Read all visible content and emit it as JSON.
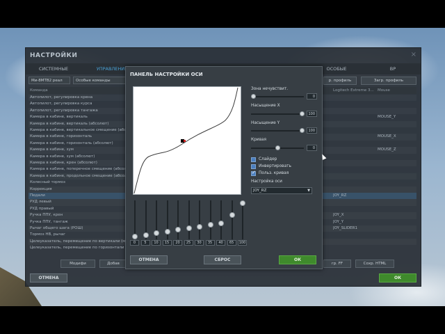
{
  "settings_window": {
    "title": "НАСТРОЙКИ",
    "close_glyph": "×",
    "tabs": [
      "СИСТЕМНЫЕ",
      "УПРАВЛЕНИЕ",
      "ОСОБЫЕ",
      "ВР"
    ],
    "aircraft_combo": "Ми-8МТВ2 реал",
    "category_combo": "Особые команды",
    "save_profile": "р. профиль",
    "load_profile": "Загр. профиль",
    "columns": [
      "Команда",
      "Logitech Extreme 3...",
      "Mouse"
    ],
    "rows": [
      {
        "cmd": "Автопилот, регулировка крена",
        "dev": "",
        "mouse": ""
      },
      {
        "cmd": "Автопилот, регулировка курса",
        "dev": "",
        "mouse": ""
      },
      {
        "cmd": "Автопилот, регулировка тангажа",
        "dev": "",
        "mouse": ""
      },
      {
        "cmd": "Камера в кабине, вертикаль",
        "dev": "",
        "mouse": "MOUSE_Y"
      },
      {
        "cmd": "Камера в кабине, вертикаль (абсолют)",
        "dev": "",
        "mouse": ""
      },
      {
        "cmd": "Камера в кабине, вертикальное смещение (абсол",
        "dev": "",
        "mouse": ""
      },
      {
        "cmd": "Камера в кабине, горизонталь",
        "dev": "",
        "mouse": "MOUSE_X"
      },
      {
        "cmd": "Камера в кабине, горизонталь (абсолют)",
        "dev": "",
        "mouse": ""
      },
      {
        "cmd": "Камера в кабине, зум",
        "dev": "",
        "mouse": "MOUSE_Z"
      },
      {
        "cmd": "Камера в кабине, зум (абсолют)",
        "dev": "",
        "mouse": ""
      },
      {
        "cmd": "Камера в кабине, крен (абсолют)",
        "dev": "",
        "mouse": ""
      },
      {
        "cmd": "Камера в кабине, поперечное смещение (абсол",
        "dev": "",
        "mouse": ""
      },
      {
        "cmd": "Камера в кабине, продольное смещение (абсол",
        "dev": "",
        "mouse": ""
      },
      {
        "cmd": "Колесный тормоз",
        "dev": "",
        "mouse": ""
      },
      {
        "cmd": "Коррекция",
        "dev": "",
        "mouse": ""
      },
      {
        "cmd": "Педали",
        "dev": "JOY_RZ",
        "mouse": ""
      },
      {
        "cmd": "РУД левый",
        "dev": "",
        "mouse": ""
      },
      {
        "cmd": "РУД правый",
        "dev": "",
        "mouse": ""
      },
      {
        "cmd": "Ручка ППУ, крен",
        "dev": "JOY_X",
        "mouse": ""
      },
      {
        "cmd": "Ручка ППУ, тангаж",
        "dev": "JOY_Y",
        "mouse": ""
      },
      {
        "cmd": "Рычаг общего шага (РОШ)",
        "dev": "JOY_SLIDER1",
        "mouse": ""
      },
      {
        "cmd": "Тормоз НВ, рычаг",
        "dev": "",
        "mouse": ""
      },
      {
        "cmd": "Целеуказатель, перемещение по вертикали (мы",
        "dev": "",
        "mouse": ""
      },
      {
        "cmd": "Целеуказатель, перемещение по горизонтали (м",
        "dev": "",
        "mouse": ""
      }
    ],
    "bottom_buttons": [
      "Модифи",
      "Добав",
      "гр. FF",
      "Сохр. HTML"
    ],
    "footer_cancel": "ОТМЕНА",
    "footer_ok": "ОК"
  },
  "axis_dialog": {
    "title": "ПАНЕЛЬ НАСТРОЙКИ ОСИ",
    "deadzone_label": "Зона нечувствит.",
    "deadzone_value": "0",
    "saturation_x_label": "Насыщение X",
    "saturation_x_value": "100",
    "saturation_y_label": "Насыщение Y",
    "saturation_y_value": "100",
    "curve_label": "Кривая",
    "curve_value": "0",
    "checkbox_slider": "Слайдер",
    "checkbox_invert": "Инвертировать",
    "checkbox_user_curve": "Польз. кривая",
    "axis_setting_label": "Настройка оси",
    "axis_value": "JOY_RZ",
    "eq_labels": [
      "0",
      "5",
      "10",
      "15",
      "20",
      "25",
      "30",
      "35",
      "40",
      "65",
      "100"
    ],
    "eq_levels": [
      0.0,
      0.05,
      0.1,
      0.15,
      0.2,
      0.25,
      0.3,
      0.35,
      0.4,
      0.65,
      1.0
    ],
    "cancel_button": "ОТМЕНА",
    "reset_button": "СБРОС",
    "ok_button": "ОК"
  },
  "colors": {
    "accent_tab": "#4aa3d8",
    "ok_green": "#3f8a2c"
  }
}
